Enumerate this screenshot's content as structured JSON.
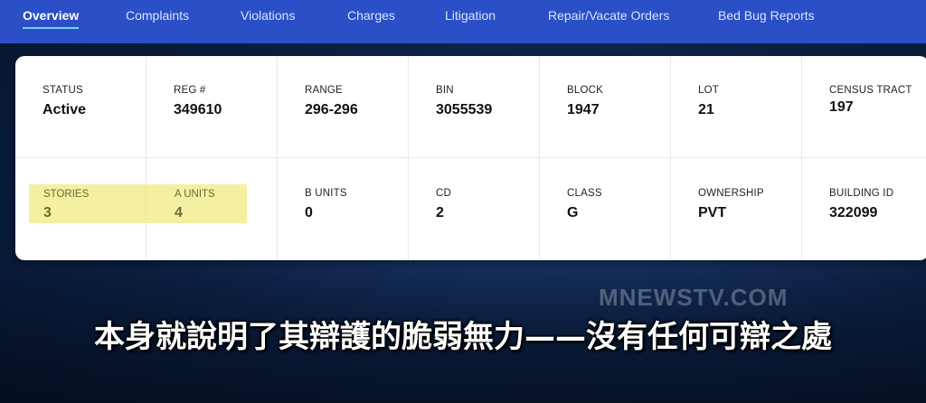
{
  "nav": {
    "items": [
      {
        "label": "Overview",
        "active": true
      },
      {
        "label": "Complaints"
      },
      {
        "label": "Violations"
      },
      {
        "label": "Charges"
      },
      {
        "label": "Litigation"
      },
      {
        "label": "Repair/Vacate Orders"
      },
      {
        "label": "Bed Bug Reports"
      }
    ]
  },
  "building": {
    "row1": [
      {
        "label": "STATUS",
        "value": "Active"
      },
      {
        "label": "REG #",
        "value": "349610"
      },
      {
        "label": "RANGE",
        "value": "296-296"
      },
      {
        "label": "BIN",
        "value": "3055539"
      },
      {
        "label": "BLOCK",
        "value": "1947"
      },
      {
        "label": "LOT",
        "value": "21"
      },
      {
        "label": "CENSUS TRACT",
        "value": "197"
      }
    ],
    "row2": [
      {
        "label": "STORIES",
        "value": "3"
      },
      {
        "label": "A UNITS",
        "value": "4"
      },
      {
        "label": "B UNITS",
        "value": "0"
      },
      {
        "label": "CD",
        "value": "2"
      },
      {
        "label": "CLASS",
        "value": "G"
      },
      {
        "label": "OWNERSHIP",
        "value": "PVT"
      },
      {
        "label": "BUILDING ID",
        "value": "322099"
      }
    ]
  },
  "overlay": {
    "watermark": "MNEWSTV.COM",
    "subtitle": "本身就說明了其辯護的脆弱無力——沒有任何可辯之處"
  },
  "colors": {
    "nav_bg": "#2a4fc7",
    "active_underline": "#6fd3ff",
    "highlight": "#eee86e"
  }
}
